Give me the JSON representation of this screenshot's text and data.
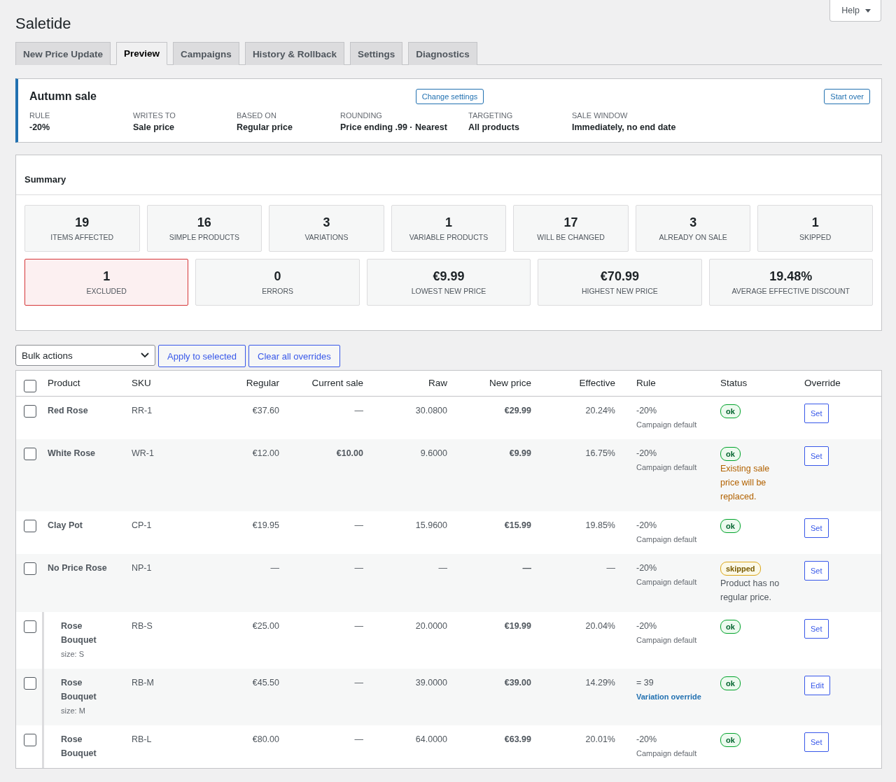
{
  "app_title": "Saletide",
  "help_button": "Help",
  "tabs": [
    {
      "label": "New Price Update",
      "selected": false
    },
    {
      "label": "Preview",
      "selected": true
    },
    {
      "label": "Campaigns",
      "selected": false
    },
    {
      "label": "History & Rollback",
      "selected": false
    },
    {
      "label": "Settings",
      "selected": false
    },
    {
      "label": "Diagnostics",
      "selected": false
    }
  ],
  "campaign": {
    "title": "Autumn sale",
    "change_button": "Change settings",
    "start_over_button": "Start over",
    "fields": [
      {
        "label": "RULE",
        "value": "-20%"
      },
      {
        "label": "WRITES TO",
        "value": "Sale price"
      },
      {
        "label": "BASED ON",
        "value": "Regular price"
      },
      {
        "label": "ROUNDING",
        "value": "Price ending .99 · Nearest"
      },
      {
        "label": "TARGETING",
        "value": "All products"
      },
      {
        "label": "SALE WINDOW",
        "value": "Immediately, no end date"
      }
    ]
  },
  "summary": {
    "title": "Summary",
    "stats_row_1": [
      {
        "value": "19",
        "label": "ITEMS AFFECTED",
        "alert": false
      },
      {
        "value": "16",
        "label": "SIMPLE PRODUCTS",
        "alert": false
      },
      {
        "value": "3",
        "label": "VARIATIONS",
        "alert": false
      },
      {
        "value": "1",
        "label": "VARIABLE PRODUCTS",
        "alert": false
      },
      {
        "value": "17",
        "label": "WILL BE CHANGED",
        "alert": false
      },
      {
        "value": "3",
        "label": "ALREADY ON SALE",
        "alert": false
      },
      {
        "value": "1",
        "label": "SKIPPED",
        "alert": false
      }
    ],
    "stats_row_2": [
      {
        "value": "1",
        "label": "EXCLUDED",
        "alert": true
      },
      {
        "value": "0",
        "label": "ERRORS",
        "alert": false
      },
      {
        "value": "€9.99",
        "label": "LOWEST NEW PRICE",
        "alert": false
      },
      {
        "value": "€70.99",
        "label": "HIGHEST NEW PRICE",
        "alert": false
      },
      {
        "value": "19.48%",
        "label": "AVERAGE EFFECTIVE DISCOUNT",
        "alert": false
      }
    ]
  },
  "bulk_actions": {
    "select": "Bulk actions",
    "apply_button": "Apply to selected",
    "clear_button": "Clear all overrides"
  },
  "table": {
    "columns": [
      "Product",
      "SKU",
      "Regular",
      "Current sale",
      "Raw",
      "New price",
      "Effective",
      "Rule",
      "Status",
      "Override"
    ],
    "header_checked": false,
    "rows": [
      {
        "kind": "product",
        "checked": false,
        "product": "Red Rose",
        "sku": "RR-1",
        "regular": "€37.60",
        "current_sale": "—",
        "raw": "30.0800",
        "new_price": "€29.99",
        "effective": "20.24%",
        "rule": "-20%",
        "rule_note": "Campaign default",
        "rule_overridden": false,
        "status": "ok",
        "skipped": false,
        "override": "Set"
      },
      {
        "kind": "product",
        "checked": false,
        "product": "White Rose",
        "sku": "WR-1",
        "regular": "€12.00",
        "current_sale": "€10.00",
        "raw": "9.6000",
        "new_price": "€9.99",
        "effective": "16.75%",
        "rule": "-20%",
        "rule_note": "Campaign default",
        "rule_overridden": false,
        "status": "ok",
        "skipped": false,
        "status_note": "Existing sale price will be replaced.",
        "warning": true,
        "override": "Set"
      },
      {
        "kind": "product",
        "checked": false,
        "product": "Clay Pot",
        "sku": "CP-1",
        "regular": "€19.95",
        "current_sale": "—",
        "raw": "15.9600",
        "new_price": "€15.99",
        "effective": "19.85%",
        "rule": "-20%",
        "rule_note": "Campaign default",
        "rule_overridden": false,
        "status": "ok",
        "skipped": false,
        "override": "Set"
      },
      {
        "kind": "product",
        "checked": false,
        "product": "No Price Rose",
        "sku": "NP-1",
        "regular": "—",
        "current_sale": "—",
        "raw": "—",
        "new_price": "—",
        "effective": "—",
        "rule": "-20%",
        "rule_note": "Campaign default",
        "rule_overridden": false,
        "status": "skipped",
        "skipped": true,
        "status_note": "Product has no regular price.",
        "warning": false,
        "override": "Set"
      },
      {
        "kind": "variation",
        "checked": false,
        "product": "Rose Bouquet",
        "attribute": "size: S",
        "sku": "RB-S",
        "regular": "€25.00",
        "current_sale": "—",
        "raw": "20.0000",
        "new_price": "€19.99",
        "effective": "20.04%",
        "rule": "-20%",
        "rule_note": "Campaign default",
        "rule_overridden": false,
        "status": "ok",
        "skipped": false,
        "override": "Set"
      },
      {
        "kind": "variation",
        "checked": false,
        "product": "Rose Bouquet",
        "attribute": "size: M",
        "sku": "RB-M",
        "regular": "€45.50",
        "current_sale": "—",
        "raw": "39.0000",
        "new_price": "€39.00",
        "effective": "14.29%",
        "rule": "= 39",
        "rule_note": "Variation override",
        "rule_overridden": true,
        "status": "ok",
        "skipped": false,
        "override": "Edit"
      },
      {
        "kind": "variation",
        "checked": false,
        "product": "Rose Bouquet",
        "sku": "RB-L",
        "regular": "€80.00",
        "current_sale": "—",
        "raw": "64.0000",
        "new_price": "€63.99",
        "effective": "20.01%",
        "rule": "-20%",
        "rule_note": "Campaign default",
        "rule_overridden": false,
        "status": "ok",
        "skipped": false,
        "override": "Set"
      }
    ]
  }
}
